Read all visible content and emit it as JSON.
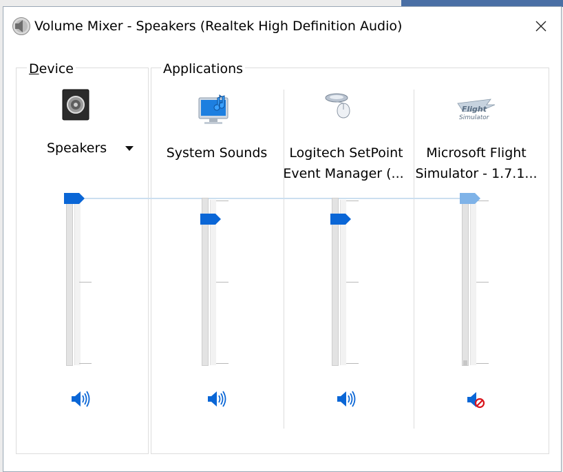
{
  "window": {
    "title": "Volume Mixer - Speakers (Realtek High Definition Audio)"
  },
  "device_section": {
    "label": "Device",
    "device_name": "Speakers",
    "level_percent": 100,
    "muted": false
  },
  "apps_section": {
    "label": "Applications",
    "apps": [
      {
        "name_line1": "System Sounds",
        "name_line2": "",
        "icon": "system-sounds-icon",
        "level_percent": 88,
        "muted": false
      },
      {
        "name_line1": "Logitech SetPoint",
        "name_line2": "Event Manager (...",
        "icon": "logitech-mouse-icon",
        "level_percent": 88,
        "muted": false
      },
      {
        "name_line1": "Microsoft Flight",
        "name_line2": "Simulator - 1.7.1...",
        "icon": "flight-simulator-icon",
        "level_percent": 100,
        "muted": true
      }
    ]
  },
  "colors": {
    "accent": "#0a66d6",
    "thumb_disabled": "#7fb3e8",
    "mute_red": "#d8131b"
  }
}
